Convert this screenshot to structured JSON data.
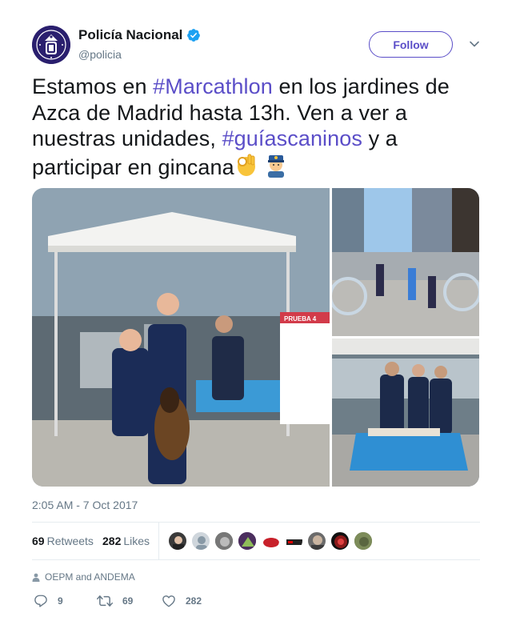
{
  "author": {
    "display_name": "Policía Nacional",
    "handle": "@policia",
    "verified": true,
    "avatar_icon": "police-badge-icon"
  },
  "follow_label": "Follow",
  "text": {
    "part1": "Estamos en ",
    "hashtag1": "#Marcathlon",
    "part2": " en los jardines de Azca de Madrid hasta 13h. Ven a ver a nuestras unidades, ",
    "hashtag2": "#guíascaninos",
    "part3": " y a participar en gincana",
    "emoji1": "👌",
    "emoji2": "👮"
  },
  "media": {
    "main_sign": "PRUEBA 4"
  },
  "timestamp": "2:05 AM - 7 Oct 2017",
  "stats": {
    "retweets_count": "69",
    "retweets_label": "Retweets",
    "likes_count": "282",
    "likes_label": "Likes",
    "likers": [
      "liker-1",
      "liker-2",
      "liker-3",
      "liker-4",
      "liker-5",
      "liker-6",
      "liker-7",
      "liker-8",
      "liker-9"
    ]
  },
  "context": "OEPM and ANDEMA",
  "actions": {
    "replies": "9",
    "retweets": "69",
    "likes": "282"
  },
  "colors": {
    "accent": "#5b4ec8",
    "verified": "#1da1f2",
    "muted": "#657786"
  }
}
